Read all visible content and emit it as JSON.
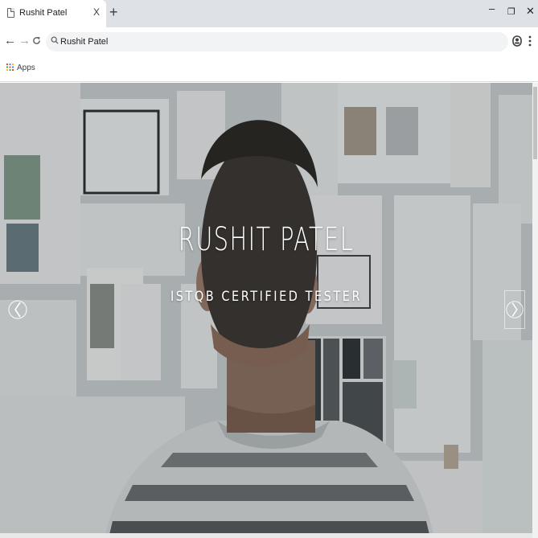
{
  "browser": {
    "tab": {
      "title": "Rushit Patel",
      "close_glyph": "X",
      "favicon": "page-icon"
    },
    "new_tab_glyph": "+",
    "window_controls": {
      "minimize": "–",
      "maximize": "❐",
      "close": "✕"
    },
    "nav": {
      "back": "←",
      "forward": "→",
      "reload": "C"
    },
    "omnibox": {
      "text": "Rushit Patel",
      "icon": "search-icon"
    },
    "bookmarks": {
      "apps_label": "Apps",
      "apps_icon": "apps-grid-icon"
    }
  },
  "hero": {
    "title": "RUSHIT PATEL",
    "subtitle": "ISTQB CERTIFIED TESTER",
    "prev_icon": "chevron-left-icon",
    "next_icon": "chevron-right-icon"
  },
  "colors": {
    "tabstrip": "#dee1e6",
    "omnibox": "#f1f3f4",
    "hero_text": "#ffffff"
  }
}
